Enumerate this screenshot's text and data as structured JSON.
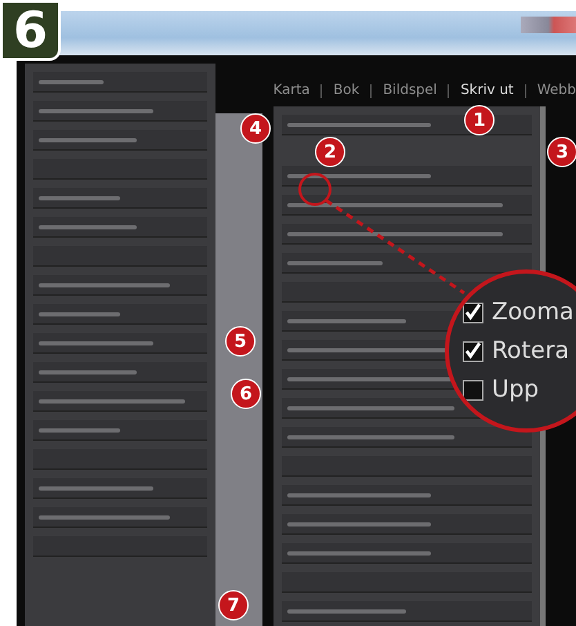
{
  "step_badge": "6",
  "module_picker": [
    {
      "label": "Karta",
      "selected": false
    },
    {
      "label": "Bok",
      "selected": false
    },
    {
      "label": "Bildspel",
      "selected": false
    },
    {
      "label": "Skriv ut",
      "selected": true
    },
    {
      "label": "Webb",
      "selected": false
    }
  ],
  "callouts": [
    "1",
    "2",
    "3",
    "4",
    "5",
    "6",
    "7"
  ],
  "magnifier": {
    "options": [
      {
        "label": "Zooma",
        "checked": true
      },
      {
        "label": "Rotera",
        "checked": true
      },
      {
        "label": "Upp",
        "checked": false
      }
    ]
  }
}
